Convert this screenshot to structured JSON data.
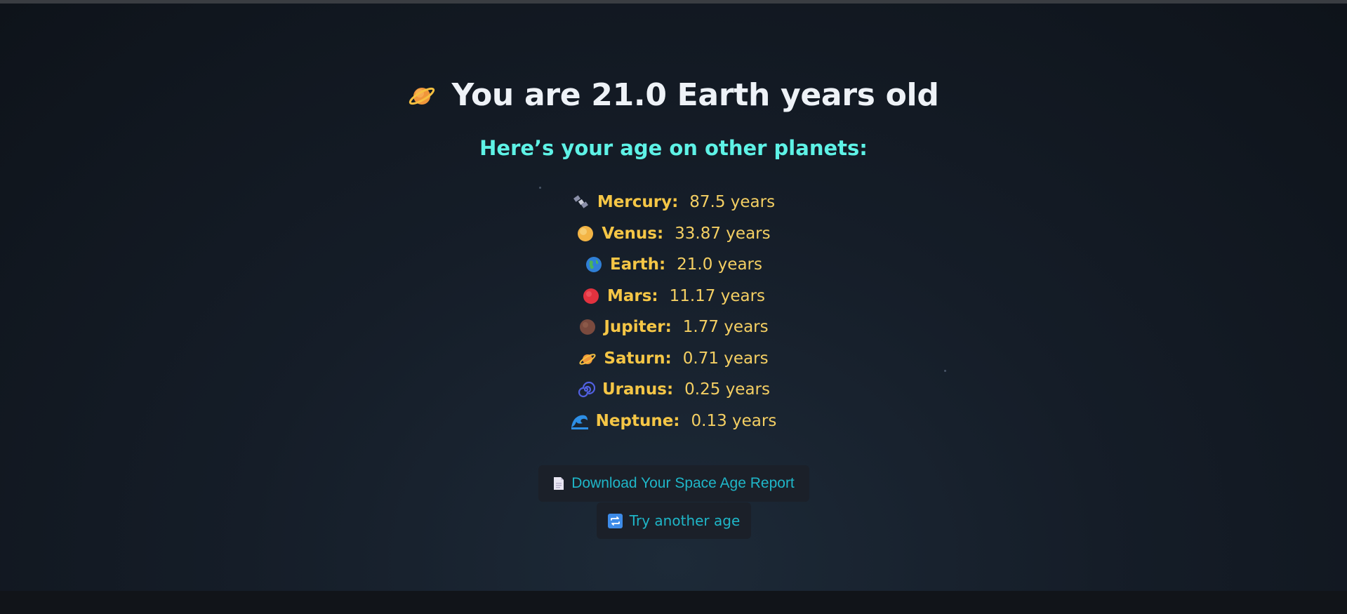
{
  "result": {
    "title": "You are 21.0 Earth years old",
    "title_icon": "ringed-planet-icon",
    "subtitle": "Here’s your age on other planets:"
  },
  "planets": [
    {
      "name": "Mercury:",
      "value": "87.5 years",
      "icon": "satellite-icon"
    },
    {
      "name": "Venus:",
      "value": "33.87 years",
      "icon": "sun-icon"
    },
    {
      "name": "Earth:",
      "value": "21.0 years",
      "icon": "globe-icon"
    },
    {
      "name": "Mars:",
      "value": "11.17 years",
      "icon": "red-circle-icon"
    },
    {
      "name": "Jupiter:",
      "value": "1.77 years",
      "icon": "brown-circle-icon"
    },
    {
      "name": "Saturn:",
      "value": "0.71 years",
      "icon": "ringed-planet-icon"
    },
    {
      "name": "Uranus:",
      "value": "0.25 years",
      "icon": "cyclone-icon"
    },
    {
      "name": "Neptune:",
      "value": "0.13 years",
      "icon": "wave-icon"
    }
  ],
  "actions": {
    "download_label": "Download Your Space Age Report",
    "download_icon": "page-icon",
    "retry_label": "Try another age",
    "retry_icon": "repeat-icon"
  },
  "colors": {
    "background": "#151d28",
    "title": "#eef2f7",
    "subtitle": "#5ef2e6",
    "planet_text": "#f5c646",
    "button_text": "#1fb6c8",
    "button_bg": "#1b2029"
  }
}
